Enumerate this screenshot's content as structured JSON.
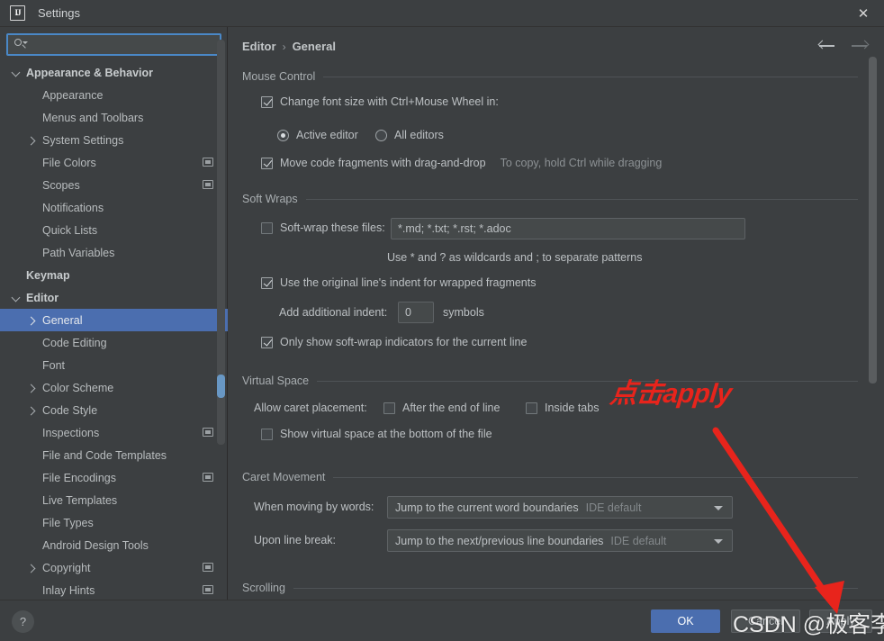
{
  "window": {
    "title": "Settings",
    "logo_text": "IJ",
    "close_label": "✕"
  },
  "search": {
    "value": "",
    "placeholder": ""
  },
  "sidebar": {
    "items": [
      {
        "label": "Appearance & Behavior",
        "indent": 0,
        "arrow": "down",
        "bold": true,
        "icon": false,
        "selected": false
      },
      {
        "label": "Appearance",
        "indent": 1,
        "arrow": "none",
        "bold": false,
        "icon": false,
        "selected": false
      },
      {
        "label": "Menus and Toolbars",
        "indent": 1,
        "arrow": "none",
        "bold": false,
        "icon": false,
        "selected": false
      },
      {
        "label": "System Settings",
        "indent": 1,
        "arrow": "right",
        "bold": false,
        "icon": false,
        "selected": false
      },
      {
        "label": "File Colors",
        "indent": 1,
        "arrow": "none",
        "bold": false,
        "icon": true,
        "selected": false
      },
      {
        "label": "Scopes",
        "indent": 1,
        "arrow": "none",
        "bold": false,
        "icon": true,
        "selected": false
      },
      {
        "label": "Notifications",
        "indent": 1,
        "arrow": "none",
        "bold": false,
        "icon": false,
        "selected": false
      },
      {
        "label": "Quick Lists",
        "indent": 1,
        "arrow": "none",
        "bold": false,
        "icon": false,
        "selected": false
      },
      {
        "label": "Path Variables",
        "indent": 1,
        "arrow": "none",
        "bold": false,
        "icon": false,
        "selected": false
      },
      {
        "label": "Keymap",
        "indent": 0,
        "arrow": "none",
        "bold": true,
        "icon": false,
        "selected": false
      },
      {
        "label": "Editor",
        "indent": 0,
        "arrow": "down",
        "bold": true,
        "icon": false,
        "selected": false
      },
      {
        "label": "General",
        "indent": 1,
        "arrow": "right",
        "bold": false,
        "icon": false,
        "selected": true
      },
      {
        "label": "Code Editing",
        "indent": 1,
        "arrow": "none",
        "bold": false,
        "icon": false,
        "selected": false
      },
      {
        "label": "Font",
        "indent": 1,
        "arrow": "none",
        "bold": false,
        "icon": false,
        "selected": false
      },
      {
        "label": "Color Scheme",
        "indent": 1,
        "arrow": "right",
        "bold": false,
        "icon": false,
        "selected": false
      },
      {
        "label": "Code Style",
        "indent": 1,
        "arrow": "right",
        "bold": false,
        "icon": false,
        "selected": false
      },
      {
        "label": "Inspections",
        "indent": 1,
        "arrow": "none",
        "bold": false,
        "icon": true,
        "selected": false
      },
      {
        "label": "File and Code Templates",
        "indent": 1,
        "arrow": "none",
        "bold": false,
        "icon": false,
        "selected": false
      },
      {
        "label": "File Encodings",
        "indent": 1,
        "arrow": "none",
        "bold": false,
        "icon": true,
        "selected": false
      },
      {
        "label": "Live Templates",
        "indent": 1,
        "arrow": "none",
        "bold": false,
        "icon": false,
        "selected": false
      },
      {
        "label": "File Types",
        "indent": 1,
        "arrow": "none",
        "bold": false,
        "icon": false,
        "selected": false
      },
      {
        "label": "Android Design Tools",
        "indent": 1,
        "arrow": "none",
        "bold": false,
        "icon": false,
        "selected": false
      },
      {
        "label": "Copyright",
        "indent": 1,
        "arrow": "right",
        "bold": false,
        "icon": true,
        "selected": false
      },
      {
        "label": "Inlay Hints",
        "indent": 1,
        "arrow": "none",
        "bold": false,
        "icon": true,
        "selected": false
      }
    ]
  },
  "breadcrumb": {
    "parent": "Editor",
    "separator": "›",
    "current": "General"
  },
  "sections": {
    "mouse_control": {
      "title": "Mouse Control",
      "change_font_size": {
        "label": "Change font size with Ctrl+Mouse Wheel in:",
        "checked": true
      },
      "scope_radio": {
        "active_editor": {
          "label": "Active editor",
          "selected": true
        },
        "all_editors": {
          "label": "All editors",
          "selected": false
        }
      },
      "drag_and_drop": {
        "label": "Move code fragments with drag-and-drop",
        "checked": true
      },
      "drag_hint": "To copy, hold Ctrl while dragging"
    },
    "soft_wraps": {
      "title": "Soft Wraps",
      "soft_wrap_files": {
        "label": "Soft-wrap these files:",
        "checked": false,
        "value": "*.md; *.txt; *.rst; *.adoc"
      },
      "wildcard_hint": "Use * and ? as wildcards and ; to separate patterns",
      "original_indent": {
        "label": "Use the original line's indent for wrapped fragments",
        "checked": true
      },
      "additional_indent": {
        "label": "Add additional indent:",
        "value": "0",
        "suffix": "symbols"
      },
      "only_current_line": {
        "label": "Only show soft-wrap indicators for the current line",
        "checked": true
      }
    },
    "virtual_space": {
      "title": "Virtual Space",
      "allow_caret_label": "Allow caret placement:",
      "after_end_of_line": {
        "label": "After the end of line",
        "checked": false
      },
      "inside_tabs": {
        "label": "Inside tabs",
        "checked": false
      },
      "show_virtual_space": {
        "label": "Show virtual space at the bottom of the file",
        "checked": false
      }
    },
    "caret_movement": {
      "title": "Caret Movement",
      "when_moving_by_words": {
        "label": "When moving by words:",
        "value": "Jump to the current word boundaries",
        "sub": "IDE default"
      },
      "upon_line_break": {
        "label": "Upon line break:",
        "value": "Jump to the next/previous line boundaries",
        "sub": "IDE default"
      }
    },
    "scrolling": {
      "title": "Scrolling"
    }
  },
  "footer": {
    "help_label": "?",
    "ok_label": "OK",
    "cancel_label": "Cancel",
    "apply_label": "Apply"
  },
  "annotations": {
    "callout_text": "点击apply",
    "watermark_text": "CSDN @极客李华",
    "callout_color": "#e8241c"
  }
}
